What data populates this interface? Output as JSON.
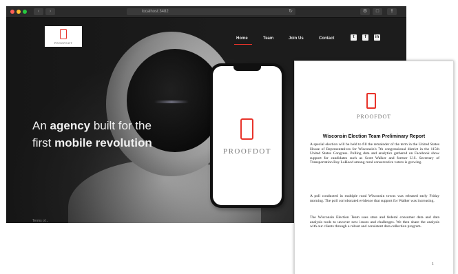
{
  "browser": {
    "url": "localhost:3482",
    "back_glyph": "‹",
    "forward_glyph": "›",
    "reload_glyph": "↻",
    "toolbar_icons": [
      "gear-icon",
      "square-icon",
      "share-icon"
    ]
  },
  "site": {
    "nav": {
      "home": "Home",
      "team": "Team",
      "join": "Join Us",
      "contact": "Contact",
      "active": "Home"
    },
    "social": {
      "twitter": "t",
      "facebook": "f",
      "linkedin": "in"
    },
    "headline": {
      "pre": "An ",
      "bold1": "agency",
      "mid": " built for the",
      "pre2": "first ",
      "bold2": "mobile revolution"
    },
    "footer_stub": "Terms of..."
  },
  "phone": {
    "brand": "PROOFDOT"
  },
  "document": {
    "brand": "PROOFDOT",
    "title": "Wisconsin Election Team Preliminary Report",
    "paragraphs": [
      "A special election will be held to fill the remainder of the term in the United States House of Representatives for Wisconsin's 7th congressional district in the 115th United States Congress. Polling data and analytics gathered on Facebook show support for candidates such as Scott Walker and former U.S. Secretary of Transportation Ray LaHood among rural conservative voters is growing.",
      "A poll conducted in multiple rural Wisconsin towns was released early Friday morning. The poll corroborated evidence that support for Walker was increasing.",
      "The Wisconsin Election Team uses state and federal consumer data and data analysis tools to uncover new issues and challenges. We then share the analysis with our clients through a robust and consistent data collection program."
    ],
    "page_number": "1"
  },
  "colors": {
    "accent": "#e8332a",
    "hero_bg": "#1c1c1c"
  }
}
